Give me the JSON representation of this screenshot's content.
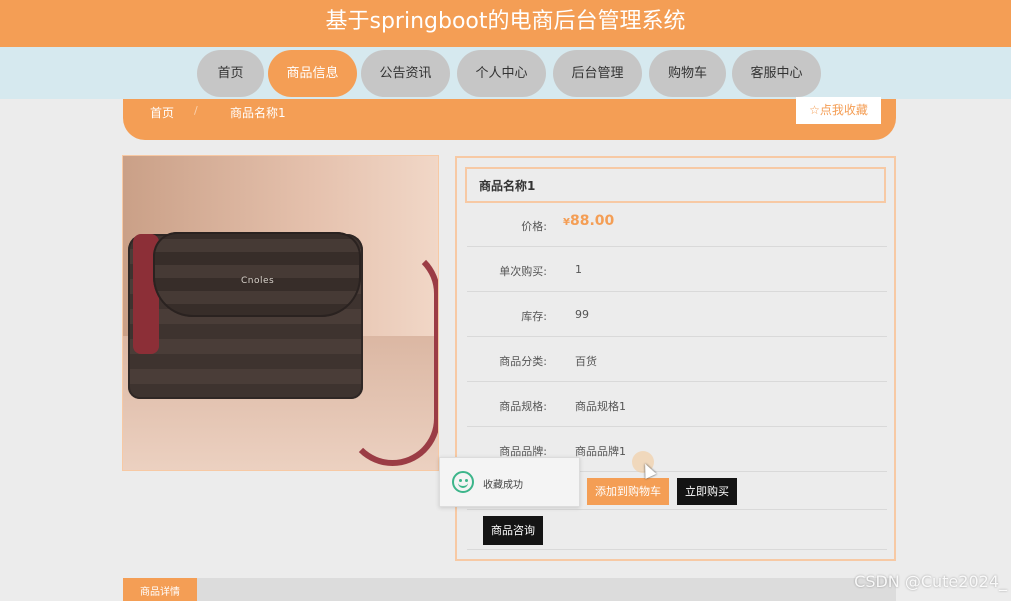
{
  "header": {
    "title": "基于springboot的电商后台管理系统"
  },
  "nav": {
    "items": [
      {
        "label": "首页",
        "active": false
      },
      {
        "label": "商品信息",
        "active": true
      },
      {
        "label": "公告资讯",
        "active": false
      },
      {
        "label": "个人中心",
        "active": false
      },
      {
        "label": "后台管理",
        "active": false
      },
      {
        "label": "购物车",
        "active": false
      },
      {
        "label": "客服中心",
        "active": false
      }
    ]
  },
  "breadcrumb": {
    "home": "首页",
    "separator": "/",
    "current": "商品名称1"
  },
  "favorite": {
    "label": "☆点我收藏"
  },
  "product": {
    "name": "商品名称1",
    "price_label": "价格:",
    "currency": "¥",
    "price": "88.00",
    "rows": [
      {
        "label": "单次购买:",
        "value": "1"
      },
      {
        "label": "库存:",
        "value": "99"
      },
      {
        "label": "商品分类:",
        "value": "百货"
      },
      {
        "label": "商品规格:",
        "value": "商品规格1"
      },
      {
        "label": "商品品牌:",
        "value": "商品品牌1"
      }
    ],
    "image_logo": "Cnoles"
  },
  "actions": {
    "add_to_cart": "添加到购物车",
    "buy_now": "立即购买",
    "consult": "商品咨询"
  },
  "toast": {
    "message": "收藏成功"
  },
  "detail": {
    "tab_label": "商品详情"
  },
  "watermark": "CSDN @Cute2024_",
  "colors": {
    "accent": "#f49e55",
    "nav_bg": "#d6e9ef",
    "nav_pill": "#c6c6c6",
    "dark_button": "#141414",
    "success": "#3cb58a"
  }
}
